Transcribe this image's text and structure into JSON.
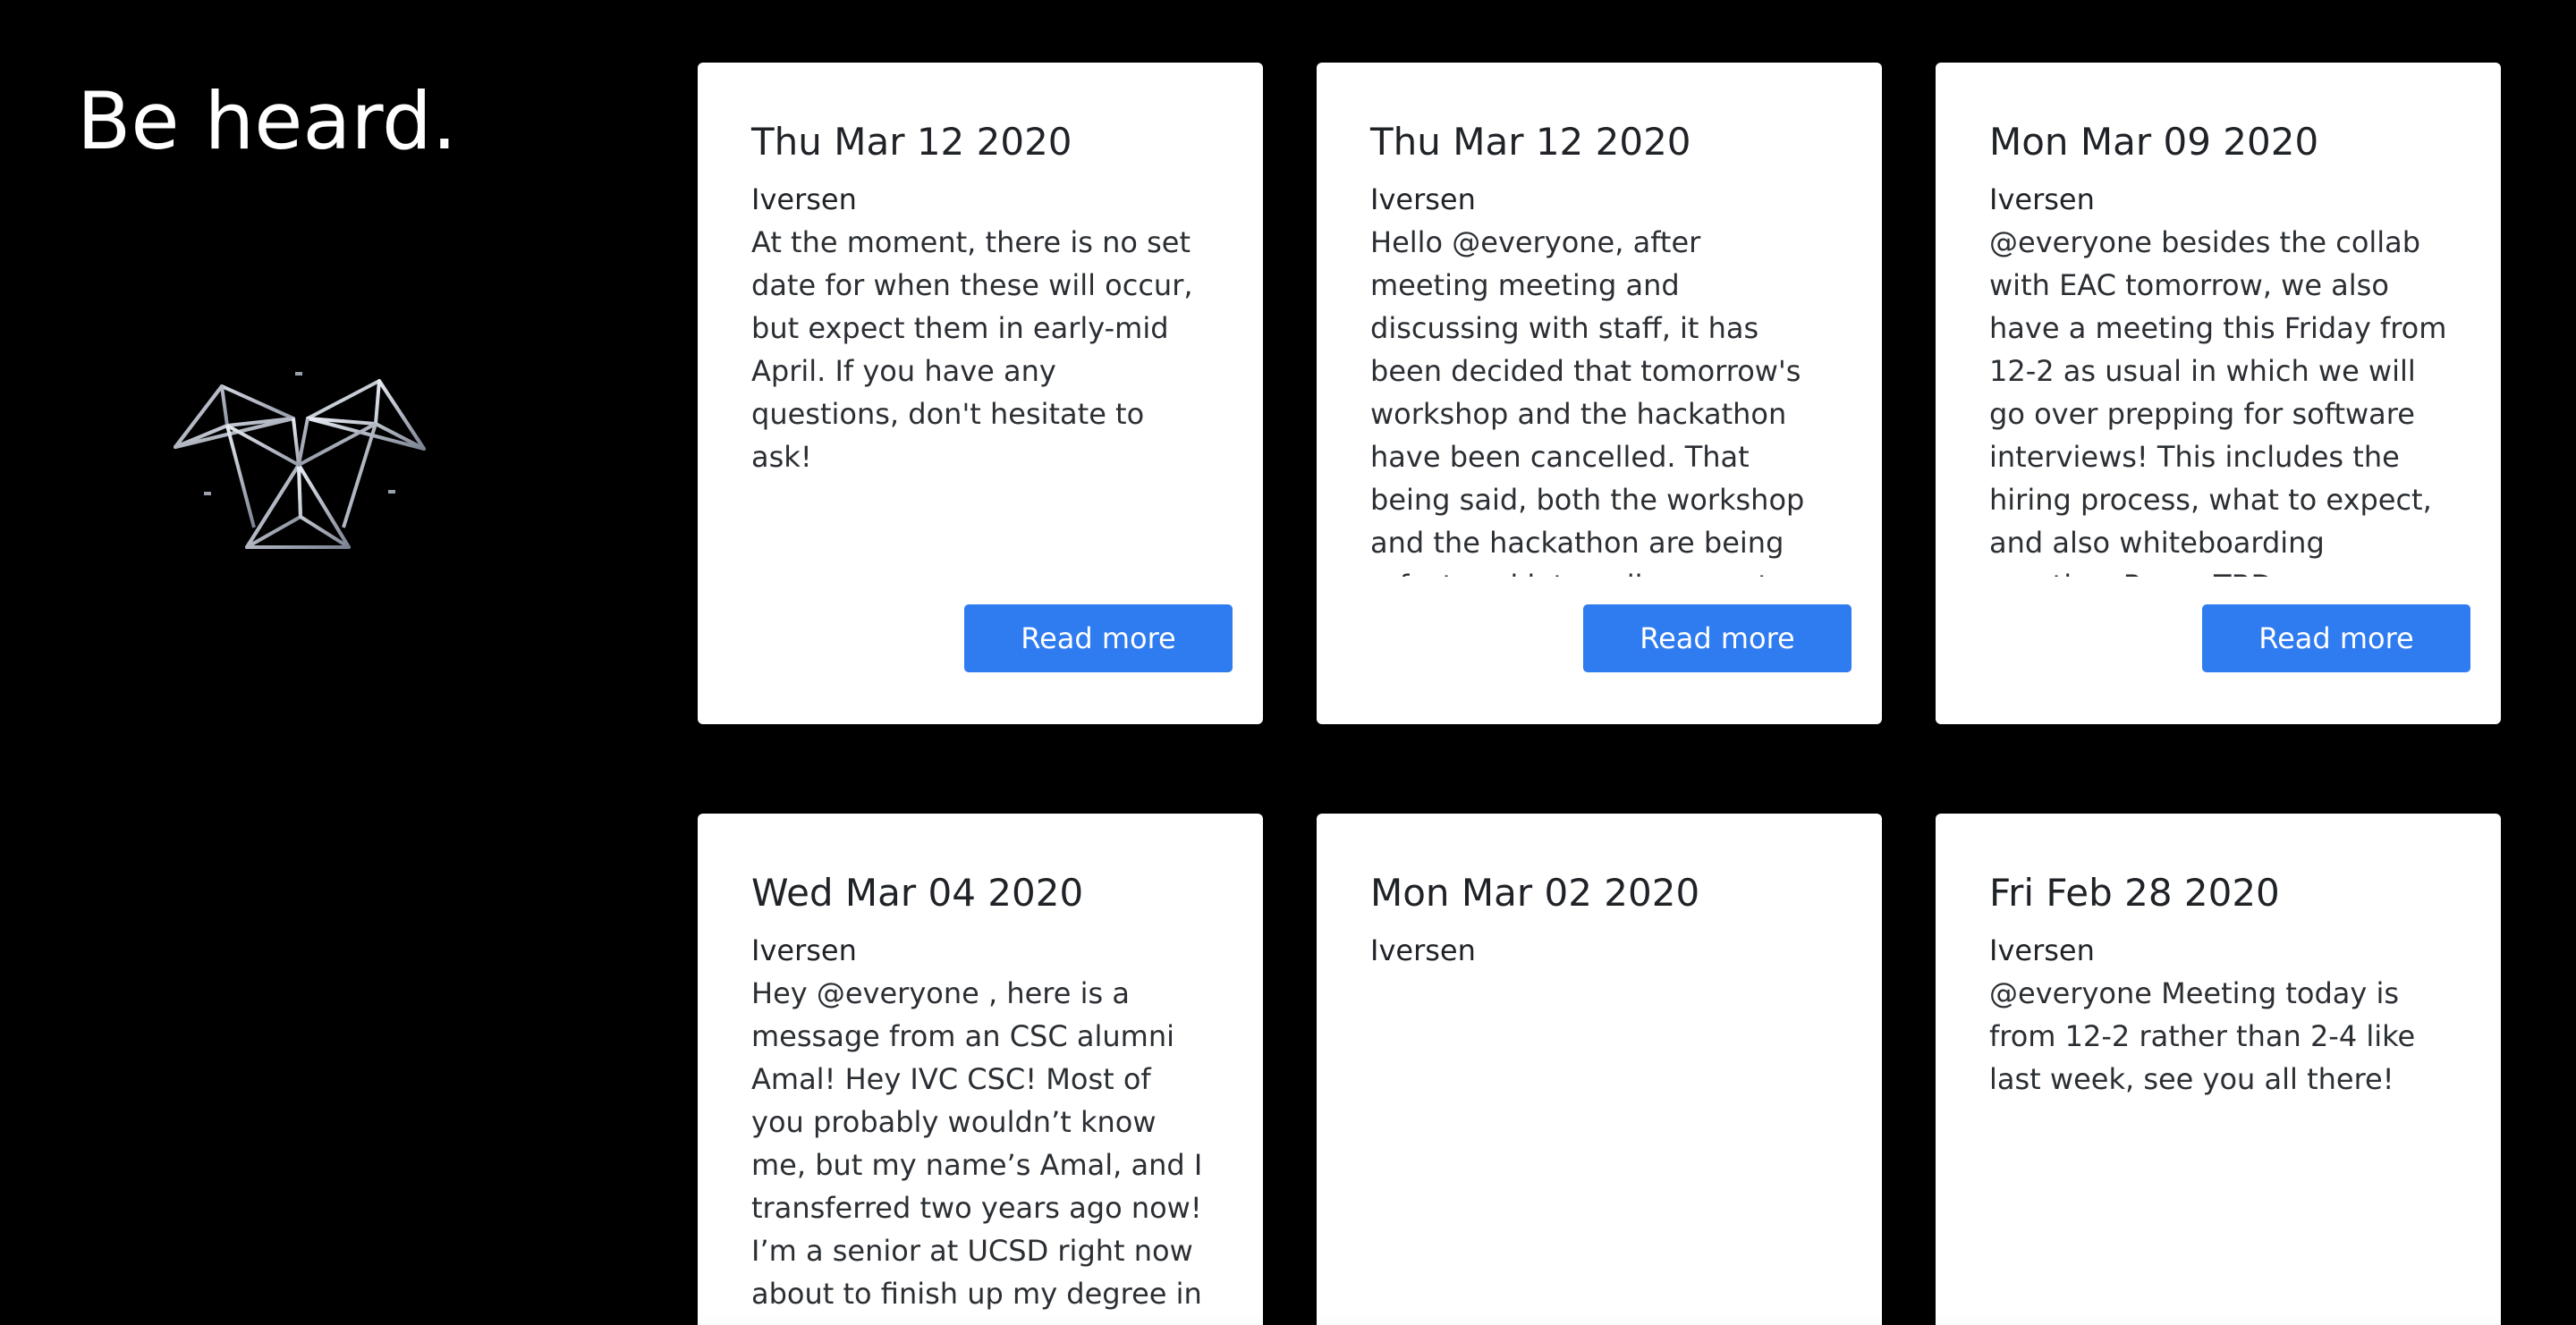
{
  "hero": {
    "title": "Be heard."
  },
  "posts": [
    {
      "date": "Thu Mar 12 2020",
      "author": "Iversen",
      "body": "At the moment, there is no set date for when these will occur, but expect them in early-mid April. If you have any questions, don't hesitate to ask!",
      "button": "Read more"
    },
    {
      "date": "Thu Mar 12 2020",
      "author": "Iversen",
      "body": "Hello @everyone, after meeting meeting and discussing with staff, it has been decided that tomorrow's workshop and the hackathon have been cancelled. That being said, both the workshop and the hackathon are being refactored into online events and still happen!",
      "button": "Read more"
    },
    {
      "date": "Mon Mar 09 2020",
      "author": "Iversen",
      "body": "@everyone besides the collab with EAC tomorrow, we also have a meeting this Friday from 12-2 as usual in which we will go over prepping for software interviews! This includes the hiring process, what to expect, and also whiteboarding practice. Room TBD.",
      "button": "Read more"
    },
    {
      "date": "Wed Mar 04 2020",
      "author": "Iversen",
      "body": "Hey @everyone , here is a message from an CSC alumni Amal! Hey IVC CSC! Most of you probably wouldn’t know me, but my name’s Amal, and I transferred two years ago now! I’m a senior at UCSD right now about to finish up my degree in"
    },
    {
      "date": "Mon Mar 02 2020",
      "author": "Iversen",
      "body": ""
    },
    {
      "date": "Fri Feb 28 2020",
      "author": "Iversen",
      "body": "@everyone Meeting today is from 12-2 rather than 2-4 like last week, see you all there!"
    }
  ],
  "logo": {
    "icon": "triangular-wireframe-logo-icon",
    "color": "#c7ccd6"
  },
  "colors": {
    "background": "#000000",
    "card": "#ffffff",
    "button": "#2f7bf0",
    "text": "#1f2226"
  }
}
